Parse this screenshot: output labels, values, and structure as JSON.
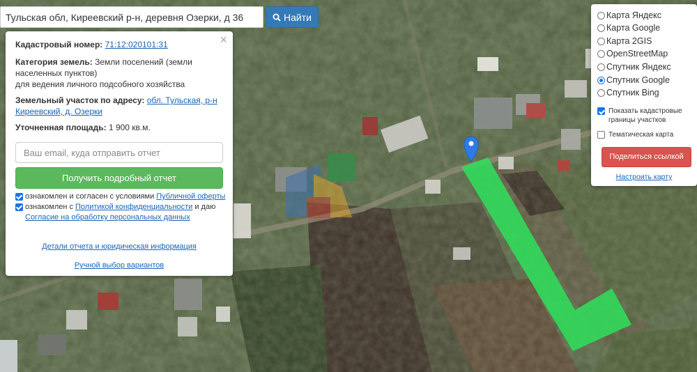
{
  "search": {
    "value": "Тульская обл, Киреевский р-н, деревня Озерки, д 36",
    "button_label": "Найти",
    "button_icon": "search-icon"
  },
  "info": {
    "cadastral_label": "Кадастровый номер:",
    "cadastral_number": "71:12:020101:31",
    "category_label": "Категория земель:",
    "category_value_1": "Земли поселений (земли",
    "category_value_2": "населенных пунктов)",
    "category_value_3": "для ведения личного подсобного хозяйства",
    "address_label": "Земельный участок по адресу:",
    "address_link_1": "обл. Тульская, р-н",
    "address_link_2": "Киреевский, д. Озерки",
    "area_label": "Уточненная площадь:",
    "area_value": "1 900 кв.м.",
    "email_placeholder": "Ваш email, куда отправить отчет",
    "report_button": "Получить подробный отчет",
    "agree_offer_text": "ознакомлен и согласен с условиями",
    "agree_offer_link": "Публичной оферты",
    "agree_privacy_text": "ознакомлен с",
    "agree_privacy_link": "Политикой конфиденциальности",
    "agree_privacy_tail": "и даю",
    "consent_link": "Согласие на обработку персональных данных",
    "details_link": "Детали отчета и юридическая информация",
    "manual_link": "Ручной выбор вариантов",
    "close_icon": "close-icon"
  },
  "layers": {
    "options": [
      "Карта Яндекс",
      "Карта Google",
      "Карта 2GIS",
      "OpenStreetMap",
      "Спутник Яндекс",
      "Спутник Google",
      "Спутник Bing"
    ],
    "selected_index": 5,
    "show_cadastral_1": "Показать кадастровые",
    "show_cadastral_2": "границы участков",
    "show_cadastral_checked": true,
    "thematic": "Тематическая карта",
    "thematic_checked": false,
    "share_button": "Поделиться ссылкой",
    "settings_link": "Настроить карту"
  },
  "colors": {
    "parcel": "#2ee05a",
    "search_button": "#337ab7",
    "report_button": "#5cb85c",
    "share_button": "#d9534f",
    "link": "#1a63b5",
    "marker": "#2c7be5"
  }
}
